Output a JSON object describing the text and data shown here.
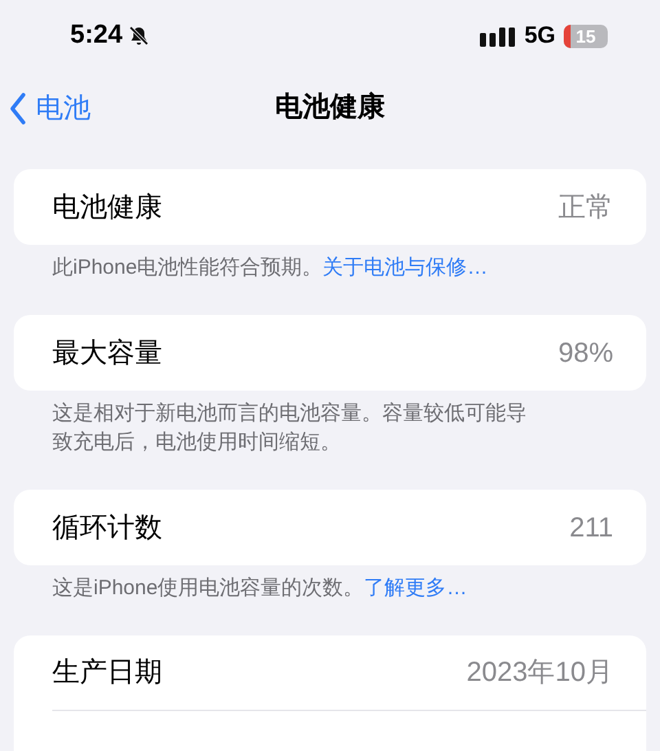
{
  "status_bar": {
    "time": "5:24",
    "network": "5G",
    "battery": {
      "label": "15",
      "level": 0.15
    }
  },
  "nav": {
    "back": "电池",
    "title": "电池健康"
  },
  "sections": [
    {
      "rows": [
        {
          "label": "电池健康",
          "value": "正常"
        }
      ],
      "footer": "此iPhone电池性能符合预期。",
      "link": "关于电池与保修…"
    },
    {
      "rows": [
        {
          "label": "最大容量",
          "value": "98%"
        }
      ],
      "footer": "这是相对于新电池而言的电池容量。容量较低可能导致充电后，电池使用时间缩短。"
    },
    {
      "rows": [
        {
          "label": "循环计数",
          "value": "211"
        }
      ],
      "footer": "这是iPhone使用电池容量的次数。",
      "link": "了解更多…"
    },
    {
      "rows": [
        {
          "label": "生产日期",
          "value": "2023年10月"
        }
      ]
    }
  ]
}
